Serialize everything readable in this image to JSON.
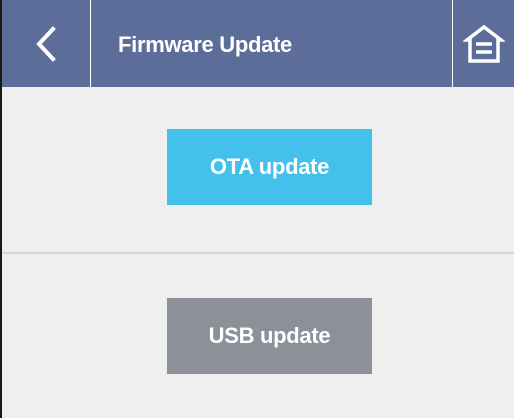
{
  "header": {
    "title": "Firmware Update",
    "back_icon": "chevron-left-icon",
    "home_icon": "home-icon"
  },
  "buttons": {
    "ota_label": "OTA update",
    "usb_label": "USB update"
  },
  "colors": {
    "header_bg": "#5d6d99",
    "ota_bg": "#43c1ec",
    "usb_bg": "#8b9099",
    "page_bg": "#efefef"
  }
}
